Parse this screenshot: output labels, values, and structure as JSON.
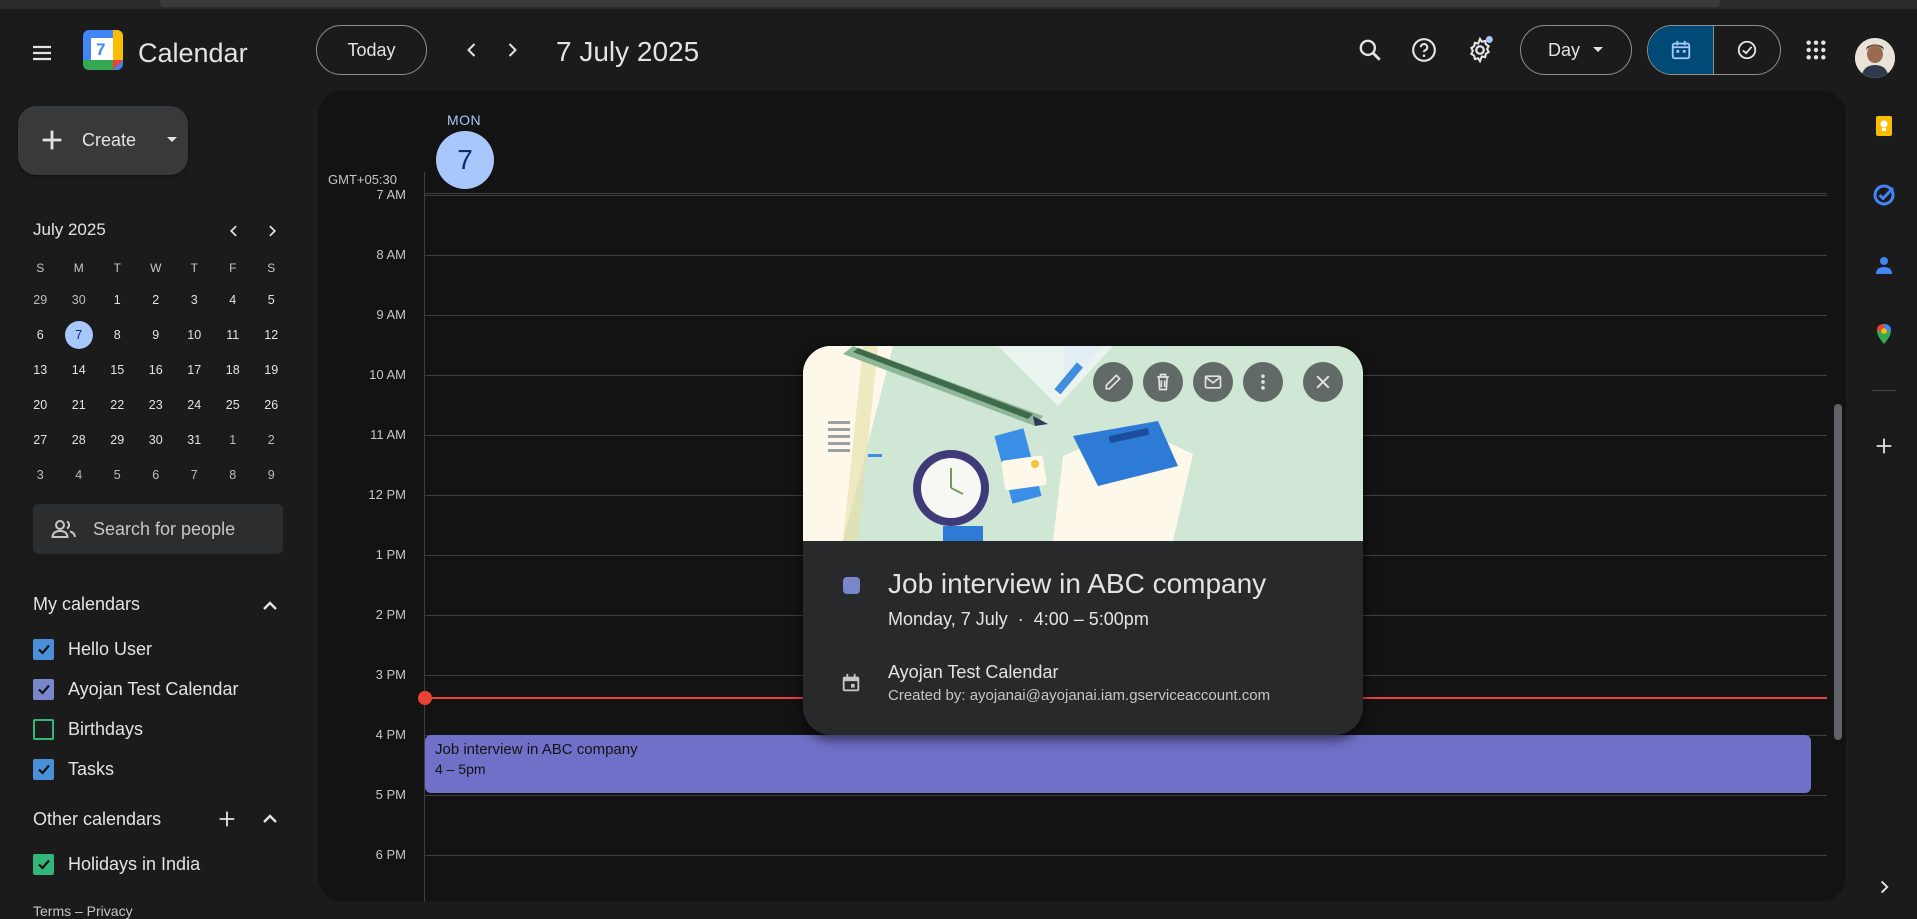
{
  "header": {
    "app_title": "Calendar",
    "logo_number": "7",
    "today_label": "Today",
    "date_title": "7 July 2025",
    "view_selector": "Day"
  },
  "sidebar": {
    "create_label": "Create",
    "mini_calendar": {
      "title": "July 2025",
      "weekdays": [
        "S",
        "M",
        "T",
        "W",
        "T",
        "F",
        "S"
      ],
      "weeks": [
        [
          "29",
          "30",
          "1",
          "2",
          "3",
          "4",
          "5"
        ],
        [
          "6",
          "7",
          "8",
          "9",
          "10",
          "11",
          "12"
        ],
        [
          "13",
          "14",
          "15",
          "16",
          "17",
          "18",
          "19"
        ],
        [
          "20",
          "21",
          "22",
          "23",
          "24",
          "25",
          "26"
        ],
        [
          "27",
          "28",
          "29",
          "30",
          "31",
          "1",
          "2"
        ],
        [
          "3",
          "4",
          "5",
          "6",
          "7",
          "8",
          "9"
        ]
      ],
      "selected_day": "7"
    },
    "search_people_placeholder": "Search for people",
    "my_calendars_title": "My calendars",
    "my_calendars": [
      {
        "name": "Hello User",
        "checked": true,
        "color": "#4a90d9"
      },
      {
        "name": "Ayojan Test Calendar",
        "checked": true,
        "color": "#7986cb"
      },
      {
        "name": "Birthdays",
        "checked": false,
        "color": "#33b679"
      },
      {
        "name": "Tasks",
        "checked": true,
        "color": "#4a90d9"
      }
    ],
    "other_calendars_title": "Other calendars",
    "other_calendars": [
      {
        "name": "Holidays in India",
        "checked": true,
        "color": "#33b679"
      }
    ],
    "footer": "Terms – Privacy"
  },
  "day_view": {
    "day_of_week": "MON",
    "day_number": "7",
    "timezone": "GMT+05:30",
    "hours": [
      "7 AM",
      "8 AM",
      "9 AM",
      "10 AM",
      "11 AM",
      "12 PM",
      "1 PM",
      "2 PM",
      "3 PM",
      "4 PM",
      "5 PM",
      "6 PM"
    ]
  },
  "event": {
    "title": "Job interview in ABC company",
    "time": "4 – 5pm",
    "color": "#7070c8"
  },
  "popup": {
    "title": "Job interview in ABC company",
    "datetime": "Monday, 7 July  ·  4:00 – 5:00pm",
    "calendar_name": "Ayojan Test Calendar",
    "created_by": "Created by: ayojanai@ayojanai.iam.gserviceaccount.com",
    "color": "#7986cb"
  },
  "colors": {
    "accent": "#a8c7fa",
    "now_line": "#ea4335",
    "selected_view": "#004a77"
  }
}
